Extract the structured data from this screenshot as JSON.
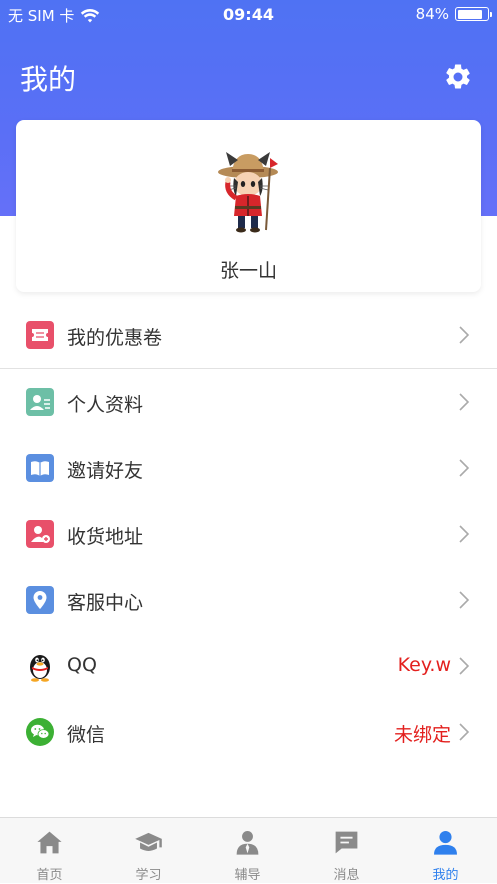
{
  "status_bar": {
    "carrier": "无 SIM 卡",
    "time": "09:44",
    "battery": "84%",
    "battery_level": 0.84
  },
  "header": {
    "title": "我的"
  },
  "profile": {
    "username": "张一山"
  },
  "menu": {
    "items": [
      {
        "label": "我的优惠卷",
        "value": ""
      },
      {
        "label": "个人资料",
        "value": ""
      },
      {
        "label": "邀请好友",
        "value": ""
      },
      {
        "label": "收货地址",
        "value": ""
      },
      {
        "label": "客服中心",
        "value": ""
      },
      {
        "label": "QQ",
        "value": "Key.w"
      },
      {
        "label": "微信",
        "value": "未绑定"
      }
    ]
  },
  "tabbar": {
    "tabs": [
      {
        "label": "首页",
        "icon": "home-icon"
      },
      {
        "label": "学习",
        "icon": "graduation-cap-icon"
      },
      {
        "label": "辅导",
        "icon": "tutor-icon"
      },
      {
        "label": "消息",
        "icon": "message-icon"
      },
      {
        "label": "我的",
        "icon": "person-icon"
      }
    ],
    "active": "我的"
  },
  "colors": {
    "header_gradient_top": "#4f72f3",
    "header_gradient_bottom": "#6570f8",
    "accent": "#2f80ed",
    "value_red": "#e3201e",
    "coupon_icon": "#e8506a",
    "profile_icon": "#6dbfa6",
    "invite_icon": "#5b8fe0",
    "address_icon": "#e8506a",
    "service_icon": "#5b8fe0",
    "wechat_icon": "#3cb034"
  }
}
